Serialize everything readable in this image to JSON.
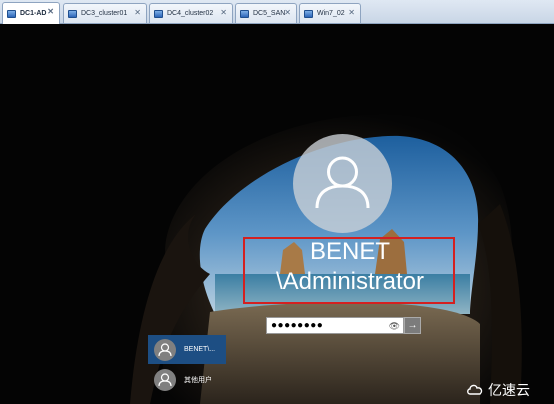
{
  "tabs": [
    {
      "label": "DC1-AD",
      "active": true
    },
    {
      "label": "DC3_cluster01",
      "active": false
    },
    {
      "label": "DC4_cluster02",
      "active": false
    },
    {
      "label": "DC5_SAN",
      "active": false
    },
    {
      "label": "Win7_02",
      "active": false
    }
  ],
  "login": {
    "username_line1": "BENET",
    "username_line2": "\\Administrator",
    "password_mask": "●●●●●●●●",
    "reveal_icon": "eye-icon",
    "submit_icon": "arrow-right-icon"
  },
  "users": [
    {
      "label": "BENET\\...",
      "selected": true
    },
    {
      "label": "其他用户",
      "selected": false
    }
  ],
  "watermark": {
    "text": "亿速云"
  },
  "colors": {
    "selected_user": "#1d4e83",
    "highlight_box": "#d42020"
  }
}
